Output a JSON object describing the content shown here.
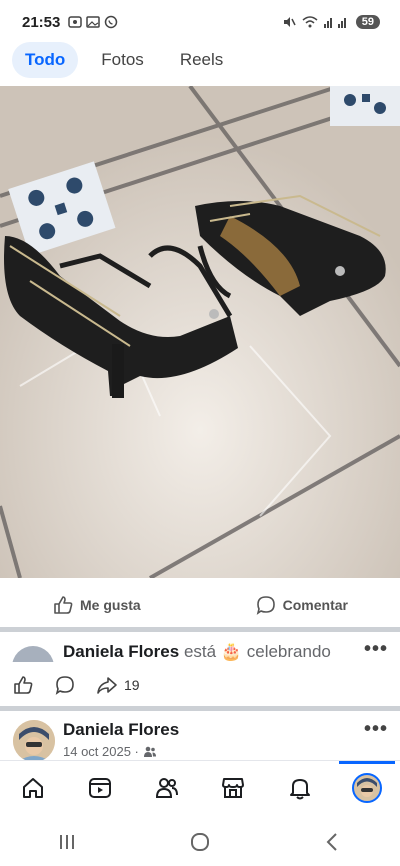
{
  "status": {
    "time": "21:53",
    "battery": "59"
  },
  "tabs": [
    {
      "label": "Todo"
    },
    {
      "label": "Fotos"
    },
    {
      "label": "Reels"
    }
  ],
  "actions": {
    "like": "Me gusta",
    "comment": "Comentar"
  },
  "activity": {
    "name": "Daniela Flores",
    "verb": "está",
    "emoji": "🎂",
    "action": "celebrando"
  },
  "reactions": {
    "shares": "19"
  },
  "post": {
    "author": "Daniela Flores",
    "date": "14 oct 2025 ·"
  },
  "colors": {
    "accent": "#0866ff",
    "active_tab_bg": "#e7f0fc"
  }
}
